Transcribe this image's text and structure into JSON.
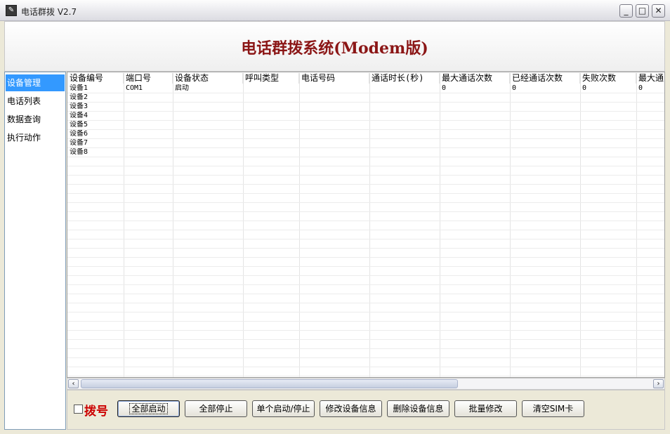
{
  "window": {
    "title": "电话群拨 V2.7"
  },
  "header": {
    "title": "电话群拨系统(Modem版)"
  },
  "sidebar": {
    "items": [
      "设备管理",
      "电话列表",
      "数据查询",
      "执行动作"
    ],
    "selected": 0
  },
  "grid": {
    "columns": [
      "设备编号",
      "端口号",
      "设备状态",
      "呼叫类型",
      "电话号码",
      "通话时长(秒)",
      "最大通话次数",
      "已经通话次数",
      "失败次数",
      "最大通"
    ],
    "rows": [
      [
        "设备1",
        "COM1",
        "启动",
        "",
        "",
        "",
        "0",
        "0",
        "0",
        "0"
      ],
      [
        "设备2",
        "",
        "",
        "",
        "",
        "",
        "",
        "",
        "",
        ""
      ],
      [
        "设备3",
        "",
        "",
        "",
        "",
        "",
        "",
        "",
        "",
        ""
      ],
      [
        "设备4",
        "",
        "",
        "",
        "",
        "",
        "",
        "",
        "",
        ""
      ],
      [
        "设备5",
        "",
        "",
        "",
        "",
        "",
        "",
        "",
        "",
        ""
      ],
      [
        "设备6",
        "",
        "",
        "",
        "",
        "",
        "",
        "",
        "",
        ""
      ],
      [
        "设备7",
        "",
        "",
        "",
        "",
        "",
        "",
        "",
        "",
        ""
      ],
      [
        "设备8",
        "",
        "",
        "",
        "",
        "",
        "",
        "",
        "",
        ""
      ]
    ]
  },
  "controls": {
    "dial_checkbox_label": "拨号",
    "buttons": [
      "全部启动",
      "全部停止",
      "单个启动/停止",
      "修改设备信息",
      "删除设备信息",
      "批量修改",
      "清空SIM卡"
    ]
  },
  "colors": {
    "title_red": "#8B1616",
    "dial_red": "#CC0000",
    "selection_blue": "#3399FF"
  }
}
